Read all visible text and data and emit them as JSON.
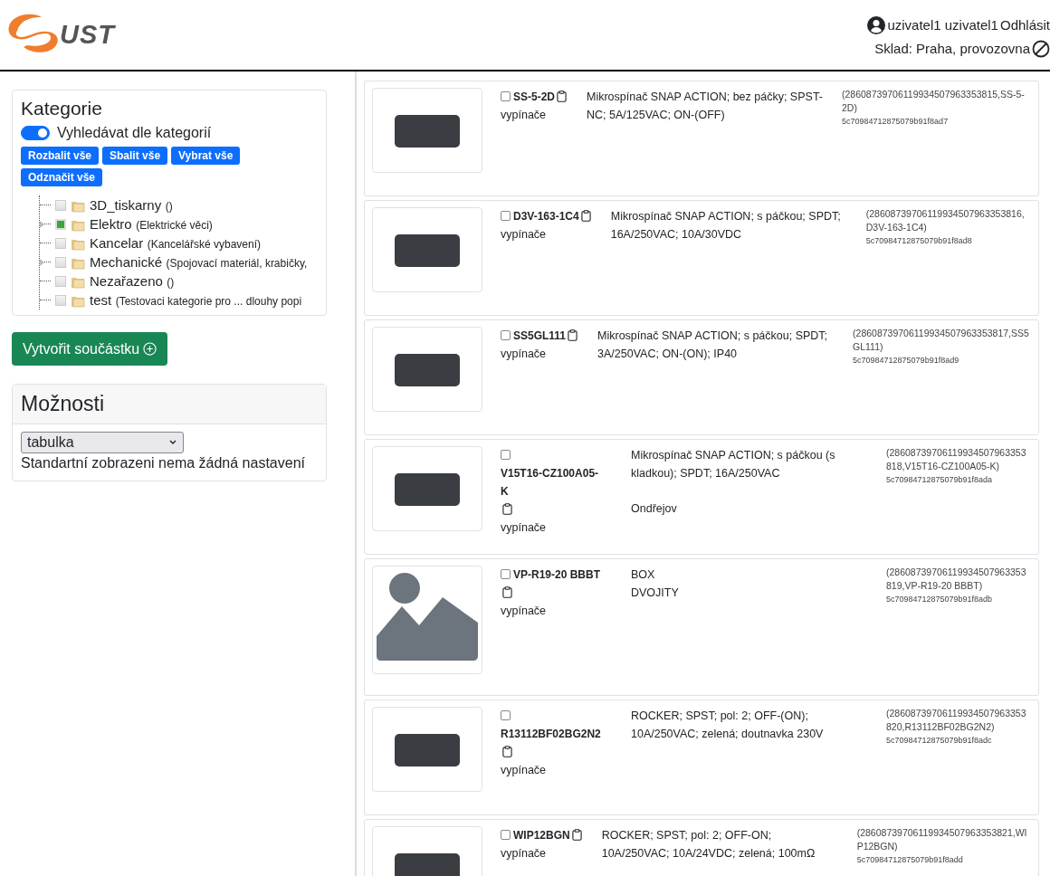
{
  "header": {
    "logo_text": "UST",
    "user": "uzivatel1 uzivatel1",
    "logout": "Odhlásit",
    "warehouse": "Sklad: Praha, provozovna"
  },
  "categories": {
    "title": "Kategorie",
    "search_toggle": {
      "label": "Vyhledávat dle kategorií",
      "on": true
    },
    "buttons": [
      "Rozbalit vše",
      "Sbalit vše",
      "Vybrat vše",
      "Odznačit vše"
    ],
    "tree": [
      {
        "name": "3D_tiskarny",
        "description": "()",
        "checked": false,
        "expandable": false
      },
      {
        "name": "Elektro",
        "description": "(Elektrické věci)",
        "checked": true,
        "expandable": true
      },
      {
        "name": "Kancelar",
        "description": "(Kancelářské vybavení)",
        "checked": false,
        "expandable": false
      },
      {
        "name": "Mechanické",
        "description": "(Spojovací materiál, krabičky,",
        "checked": false,
        "expandable": true
      },
      {
        "name": "Nezařazeno",
        "description": "()",
        "checked": false,
        "expandable": false
      },
      {
        "name": "test",
        "description": "(Testovaci kategorie pro ... dlouhy popi",
        "checked": false,
        "expandable": false
      }
    ]
  },
  "create_button": "Vytvořit součástku",
  "options": {
    "title": "Možnosti",
    "view_select": "tabulka",
    "note": "Standartní zobrazeni nema žádná nastavení"
  },
  "products": [
    {
      "kind": "photo",
      "checked": false,
      "code": "SS-5-2D",
      "category": "vypínače",
      "description": [
        "Mikrospínač SNAP ACTION; bez páčky; SPST-NC; 5A/125VAC; ON-(OFF)"
      ],
      "ref": "(28608739706119934507963353815,SS-5-2D)",
      "hash": "5c70984712875079b91f8ad7"
    },
    {
      "kind": "photo",
      "checked": false,
      "code": "D3V-163-1C4",
      "category": "vypínače",
      "description": [
        "Mikrospínač SNAP ACTION; s páčkou; SPDT; 16A/250VAC; 10A/30VDC"
      ],
      "ref": "(28608739706119934507963353816,D3V-163-1C4)",
      "hash": "5c70984712875079b91f8ad8"
    },
    {
      "kind": "photo",
      "checked": false,
      "code": "SS5GL111",
      "category": "vypínače",
      "description": [
        "Mikrospínač SNAP ACTION; s páčkou; SPDT; 3A/250VAC; ON-(ON); IP40"
      ],
      "ref": "(28608739706119934507963353817,SS5GL111)",
      "hash": "5c70984712875079b91f8ad9"
    },
    {
      "kind": "photo",
      "checked": false,
      "code": "V15T16-CZ100A05-K",
      "category": "vypínače",
      "description": [
        "Mikrospínač SNAP ACTION; s páčkou (s kladkou); SPDT; 16A/250VAC"
      ],
      "location": "Ondřejov",
      "ref": "(28608739706119934507963353818,V15T16-CZ100A05-K)",
      "hash": "5c70984712875079b91f8ada"
    },
    {
      "kind": "placeholder",
      "checked": false,
      "code": "VP-R19-20 BBBT",
      "category": "vypínače",
      "description": [
        "BOX",
        "DVOJITY"
      ],
      "ref": "(28608739706119934507963353819,VP-R19-20 BBBT)",
      "hash": "5c70984712875079b91f8adb"
    },
    {
      "kind": "photo",
      "checked": false,
      "code": "R13112BF02BG2N2",
      "category": "vypínače",
      "description": [
        "ROCKER; SPST; pol: 2; OFF-(ON); 10A/250VAC; zelená; doutnavka 230V"
      ],
      "ref": "(28608739706119934507963353820,R13112BF02BG2N2)",
      "hash": "5c70984712875079b91f8adc"
    },
    {
      "kind": "photo",
      "checked": false,
      "code": "WIP12BGN",
      "category": "vypínače",
      "description": [
        "ROCKER; SPST; pol: 2; OFF-ON; 10A/250VAC; 10A/24VDC; zelená; 100mΩ"
      ],
      "ref": "(28608739706119934507963353821,WIP12BGN)",
      "hash": "5c70984712875079b91f8add"
    }
  ]
}
